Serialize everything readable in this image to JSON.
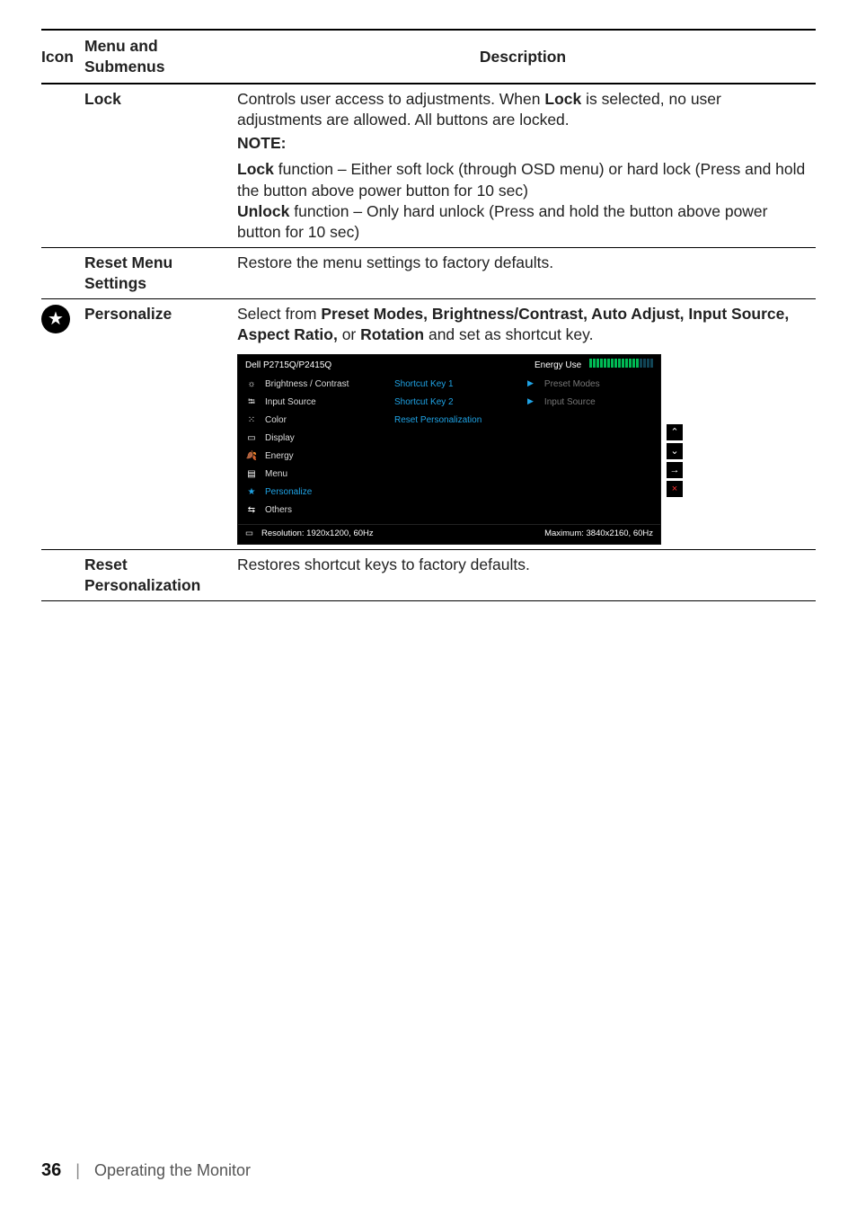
{
  "table": {
    "headers": {
      "icon": "Icon",
      "menu": "Menu and Submenus",
      "desc": "Description"
    },
    "rows": {
      "lock": {
        "menu": "Lock",
        "desc_line1a": "Controls user access to adjustments. When ",
        "desc_line1b_bold": "Lock",
        "desc_line1c": " is selected, no user adjustments are allowed. All buttons are locked.",
        "note_label": "NOTE:",
        "note_b1_bold": "Lock",
        "note_b1_text": " function – Either soft lock (through OSD menu) or hard lock (Press and hold the button above power button for 10 sec)",
        "note_b2_bold": "Unlock",
        "note_b2_text": " function – Only hard unlock (Press and hold the button above power button for 10 sec)"
      },
      "reset_menu": {
        "menu": "Reset Menu Settings",
        "desc": "Restore the menu settings to factory defaults."
      },
      "personalize": {
        "menu": "Personalize",
        "desc_a": "Select from ",
        "desc_b_bold": "Preset Modes, Brightness/Contrast, Auto Adjust, Input Source, Aspect Ratio,",
        "desc_c": " or ",
        "desc_d_bold": "Rotation",
        "desc_e": " and set as shortcut key."
      },
      "reset_personalization": {
        "menu": "Reset Personalization",
        "desc": "Restores shortcut keys to factory defaults."
      }
    }
  },
  "osd": {
    "model": "Dell P2715Q/P2415Q",
    "energy_label": "Energy Use",
    "left": [
      {
        "icon": "brightness",
        "label": "Brightness / Contrast"
      },
      {
        "icon": "input",
        "label": "Input Source"
      },
      {
        "icon": "color",
        "label": "Color"
      },
      {
        "icon": "display",
        "label": "Display"
      },
      {
        "icon": "energy",
        "label": "Energy"
      },
      {
        "icon": "menu",
        "label": "Menu"
      },
      {
        "icon": "personalize",
        "label": "Personalize",
        "selected": true
      },
      {
        "icon": "others",
        "label": "Others"
      }
    ],
    "mid": [
      {
        "label": "Shortcut Key 1"
      },
      {
        "label": "Shortcut Key 2"
      },
      {
        "label": "Reset Personalization"
      }
    ],
    "right": [
      {
        "label": "Preset Modes",
        "arrow": true
      },
      {
        "label": "Input Source",
        "arrow": true
      }
    ],
    "bottom_left": "Resolution: 1920x1200, 60Hz",
    "bottom_right": "Maximum: 3840x2160, 60Hz",
    "side_btns": {
      "up": "⌃",
      "down": "⌄",
      "enter": "→",
      "close": "×"
    }
  },
  "footer": {
    "page": "36",
    "sep": "|",
    "title": "Operating the Monitor"
  }
}
